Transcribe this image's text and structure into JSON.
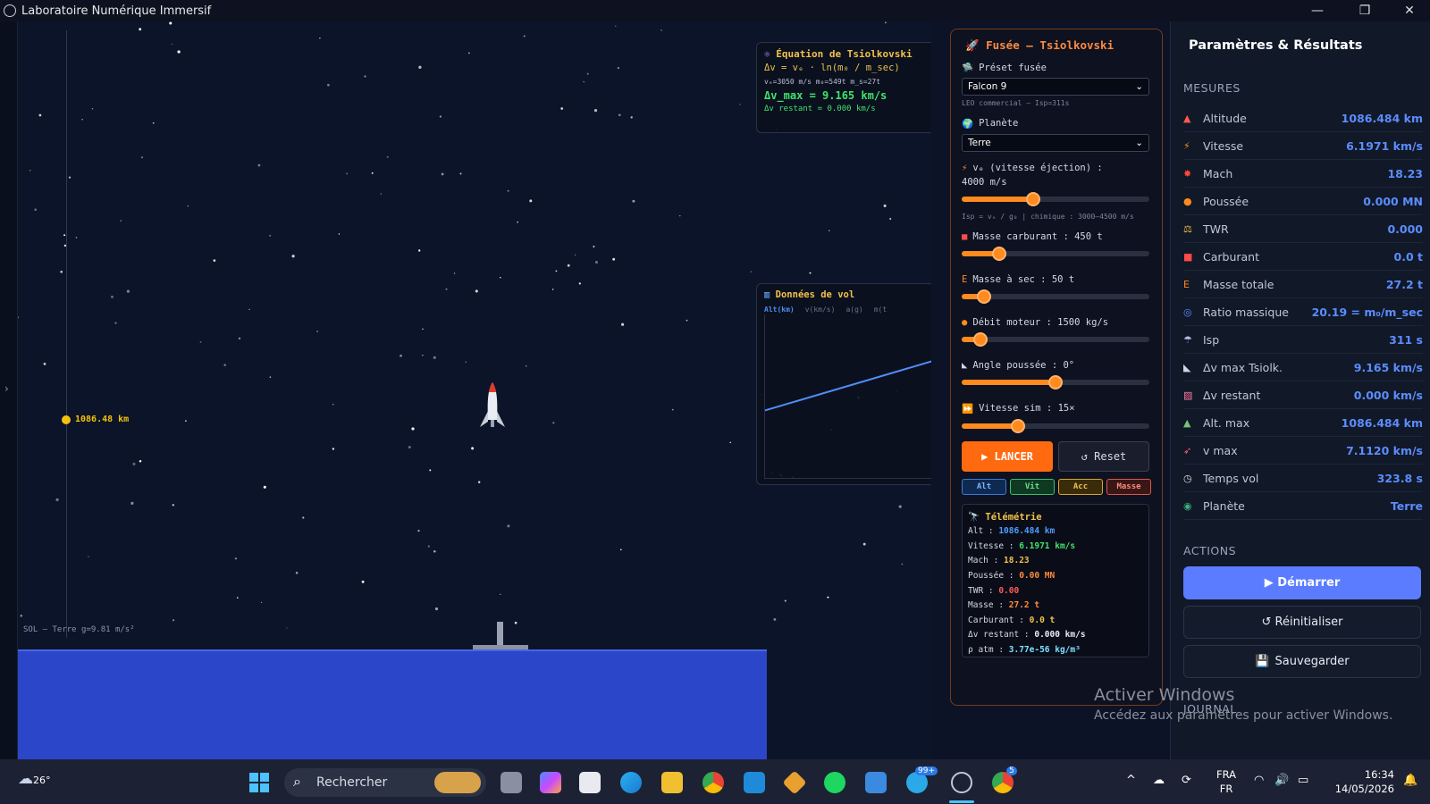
{
  "window": {
    "title": "Laboratoire Numérique Immersif"
  },
  "scene": {
    "ground_label": "SOL — Terre  g=9.81 m/s²",
    "alt_marker": "1086.48 km",
    "collapse_glyph": "›"
  },
  "tsiolkovski": {
    "title": "Équation de Tsiolkovski",
    "formula": "Δv = vₑ · ln(m₀ / m_sec)",
    "params": "vₑ=3050 m/s  m₀=549t  m_s=27t",
    "dv_max": "Δv_max = 9.165 km/s",
    "dv_rest": "Δv restant = 0.000 km/s"
  },
  "flight": {
    "title": "Données de vol",
    "tabs": [
      "Alt(km)",
      "v(km/s)",
      "a(g)",
      "m(t"
    ]
  },
  "control": {
    "title": "Fusée — Tsiolkovski",
    "preset_label": "Préset fusée",
    "preset_value": "Falcon 9",
    "preset_sub": "LEO commercial — Isp=311s",
    "planet_label": "Planète",
    "planet_value": "Terre",
    "ve_label": "vₑ (vitesse éjection) :",
    "ve_value": "4000 m/s",
    "ve_sub": "Isp = vₑ / g₀ | chimique : 3000–4500 m/s",
    "fuel_label": "Masse carburant : 450 t",
    "dry_label": "Masse à sec : 50 t",
    "flow_label": "Débit moteur : 1500 kg/s",
    "angle_label": "Angle poussée : 0°",
    "speed_label": "Vitesse sim : 15×",
    "sliders": {
      "ve": 0.38,
      "fuel": 0.2,
      "dry": 0.12,
      "flow": 0.1,
      "angle": 0.5,
      "speed": 0.3
    },
    "launch_label": "▶ LANCER",
    "reset_label": "↺ Reset",
    "chips": [
      "Alt",
      "Vit",
      "Acc",
      "Masse"
    ],
    "telemetry": {
      "title": "Télémétrie",
      "rows": [
        {
          "k": "Alt : ",
          "v": "1086.484 km",
          "c": "#4f9dff"
        },
        {
          "k": "Vitesse : ",
          "v": "6.1971 km/s",
          "c": "#41e36a"
        },
        {
          "k": "Mach : ",
          "v": "18.23",
          "c": "#f0c24a"
        },
        {
          "k": "Poussée : ",
          "v": "0.00 MN",
          "c": "#ff8a3d"
        },
        {
          "k": "TWR : ",
          "v": "0.00",
          "c": "#ff5a5a"
        },
        {
          "k": "Masse : ",
          "v": "27.2 t",
          "c": "#ff8a3d"
        },
        {
          "k": "Carburant : ",
          "v": "0.0 t",
          "c": "#f0c24a"
        },
        {
          "k": "Δv restant : ",
          "v": "0.000 km/s",
          "c": "#e8ecf6"
        },
        {
          "k": "ρ atm : ",
          "v": "3.77e-56 kg/m³",
          "c": "#7ee0ff"
        }
      ]
    }
  },
  "results": {
    "title": "Paramètres & Résultats",
    "measures_header": "MESURES",
    "measures": [
      {
        "icon": "▲",
        "icolor": "#ff5a4a",
        "name": "Altitude",
        "value": "1086.484 km"
      },
      {
        "icon": "⚡",
        "icolor": "#ff8a1d",
        "name": "Vitesse",
        "value": "6.1971 km/s"
      },
      {
        "icon": "✸",
        "icolor": "#ff4a3a",
        "name": "Mach",
        "value": "18.23"
      },
      {
        "icon": "●",
        "icolor": "#ff8a1d",
        "name": "Poussée",
        "value": "0.000 MN"
      },
      {
        "icon": "⚖",
        "icolor": "#f0c24a",
        "name": "TWR",
        "value": "0.000"
      },
      {
        "icon": "■",
        "icolor": "#ff4a4a",
        "name": "Carburant",
        "value": "0.0 t"
      },
      {
        "icon": "E",
        "icolor": "#ff8a1d",
        "name": "Masse totale",
        "value": "27.2 t"
      },
      {
        "icon": "◎",
        "icolor": "#5b8dff",
        "name": "Ratio massique",
        "value": "20.19 = m₀/m_sec"
      },
      {
        "icon": "☂",
        "icolor": "#b0c0e0",
        "name": "Isp",
        "value": "311 s"
      },
      {
        "icon": "◣",
        "icolor": "#d0d6e6",
        "name": "Δv max Tsiolk.",
        "value": "9.165 km/s"
      },
      {
        "icon": "▨",
        "icolor": "#ff7aa0",
        "name": "Δv restant",
        "value": "0.000 km/s"
      },
      {
        "icon": "▲",
        "icolor": "#7ac07a",
        "name": "Alt. max",
        "value": "1086.484 km"
      },
      {
        "icon": "➶",
        "icolor": "#ff5a8a",
        "name": "v max",
        "value": "7.1120 km/s"
      },
      {
        "icon": "◷",
        "icolor": "#e0e0e0",
        "name": "Temps vol",
        "value": "323.8 s"
      },
      {
        "icon": "◉",
        "icolor": "#3ab07a",
        "name": "Planète",
        "value": "Terre"
      }
    ],
    "actions_header": "ACTIONS",
    "start_label": "▶ Démarrer",
    "reinit_label": "↺ Réinitialiser",
    "save_label": "Sauvegarder",
    "journal_header": "JOURNAL"
  },
  "watermark": {
    "line1": "Activer Windows",
    "line2": "Accédez aux paramètres pour activer Windows."
  },
  "taskbar": {
    "weather": "26°",
    "search_placeholder": "Rechercher",
    "lang1": "FRA",
    "lang2": "FR",
    "time": "16:34",
    "date": "14/05/2026",
    "badge_telegram": "99+",
    "badge_chrome": "5"
  },
  "colors": {
    "accent_orange": "#ff6a10",
    "accent_blue": "#5b7cff",
    "ground": "#2b46c9"
  }
}
